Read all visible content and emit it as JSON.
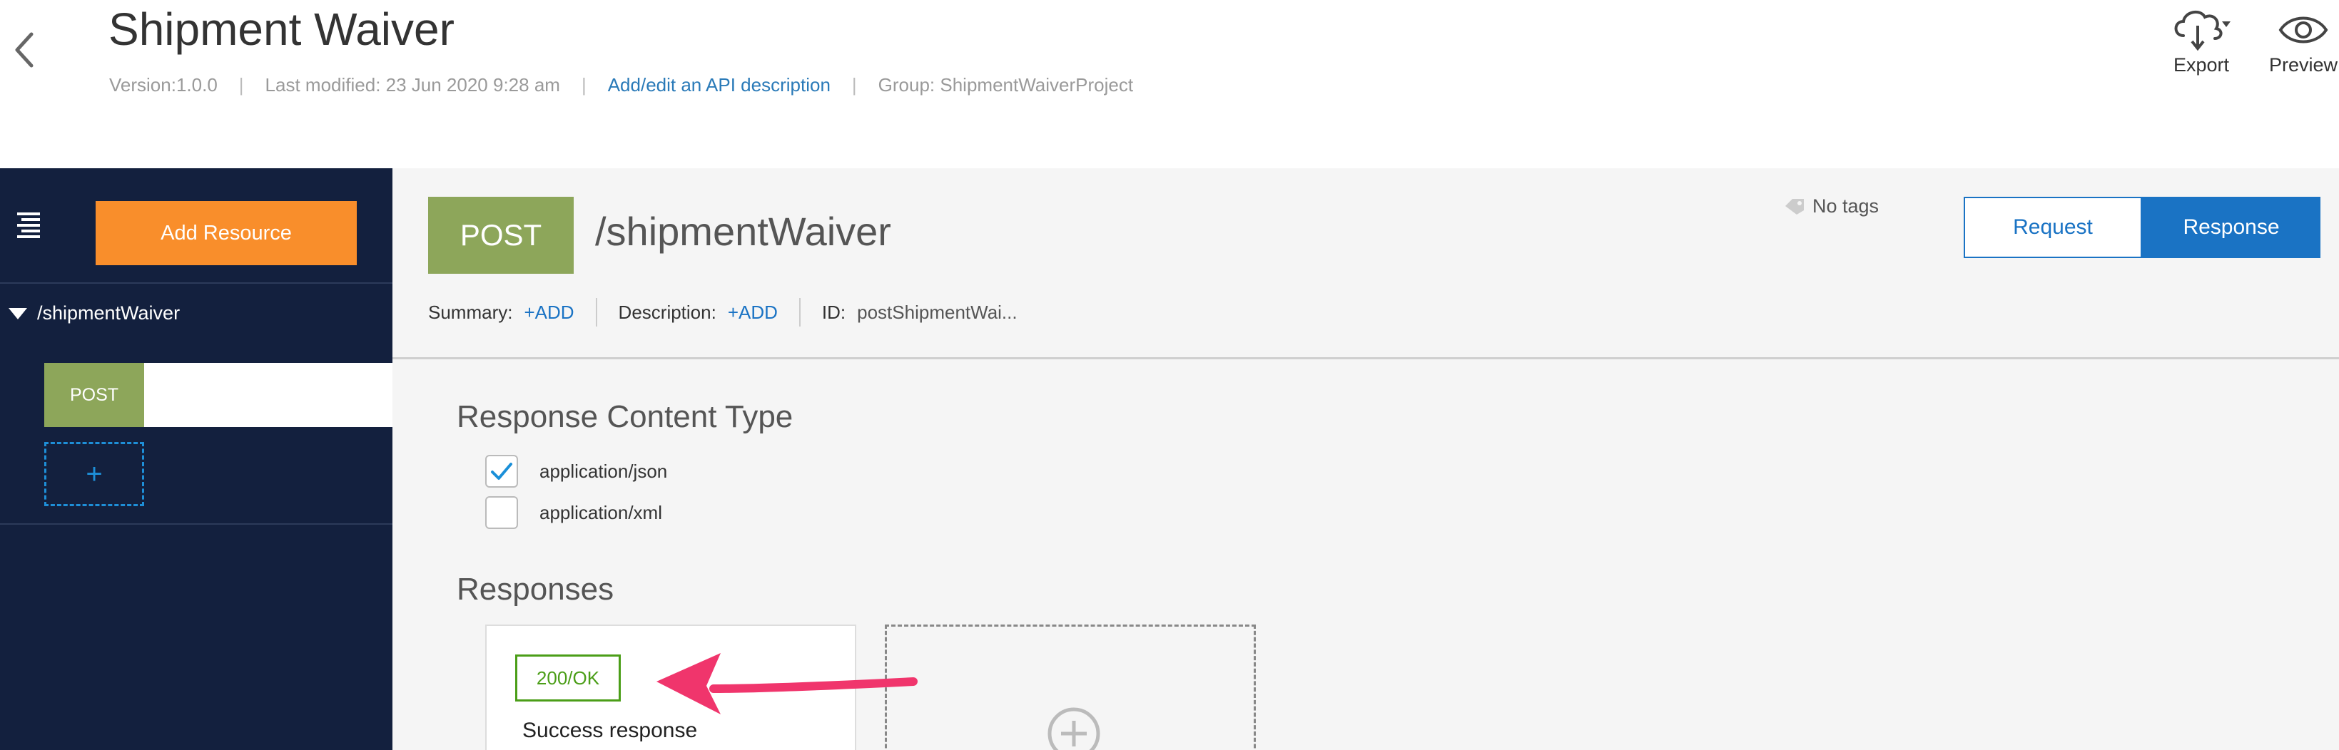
{
  "header": {
    "title": "Shipment Waiver",
    "version": "Version:1.0.0",
    "last_modified": "Last modified: 23 Jun 2020 9:28 am",
    "description_link": "Add/edit an API description",
    "group": "Group: ShipmentWaiverProject",
    "separator": "|",
    "export_label": "Export",
    "preview_label": "Preview"
  },
  "sidebar": {
    "add_resource_label": "Add Resource",
    "resource_path": "/shipmentWaiver",
    "method_label": "POST",
    "add_method_label": "+"
  },
  "operation": {
    "method": "POST",
    "path": "/shipmentWaiver",
    "no_tags": "No tags",
    "request_tab": "Request",
    "response_tab": "Response",
    "summary_label": "Summary:",
    "summary_add": "+ADD",
    "description_label": "Description:",
    "description_add": "+ADD",
    "id_label": "ID:",
    "id_value": "postShipmentWai..."
  },
  "response_content_type": {
    "title": "Response Content Type",
    "options": [
      {
        "label": "application/json",
        "checked": true
      },
      {
        "label": "application/xml",
        "checked": false
      }
    ]
  },
  "responses": {
    "title": "Responses",
    "items": [
      {
        "code": "200/OK",
        "description": "Success response"
      }
    ]
  },
  "colors": {
    "sidebar_bg": "#13203e",
    "accent_orange": "#f98e2b",
    "post_green": "#8da65a",
    "primary_blue": "#1a73c4",
    "success_green": "#4b9e18",
    "annotation_pink": "#f0356c"
  }
}
